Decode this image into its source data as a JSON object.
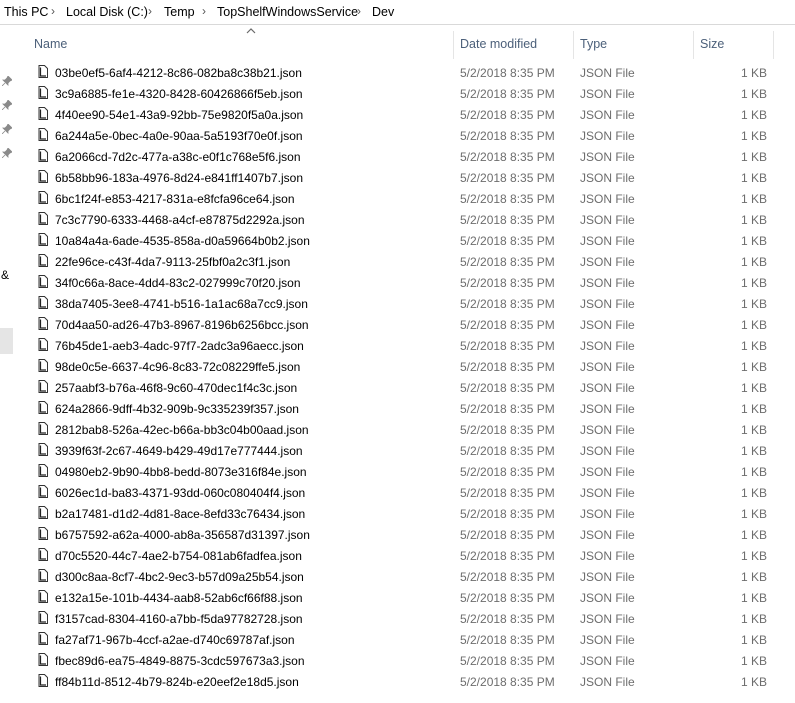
{
  "breadcrumb": {
    "items": [
      "This PC",
      "Local Disk (C:)",
      "Temp",
      "TopShelfWindowsService",
      "Dev"
    ],
    "separator": "›"
  },
  "columns": {
    "name": "Name",
    "date": "Date modified",
    "type": "Type",
    "size": "Size"
  },
  "nav": {
    "pins": [
      "pin-icon",
      "pin-icon",
      "pin-icon",
      "pin-icon"
    ],
    "amp": "&"
  },
  "files": [
    {
      "name": "03be0ef5-6af4-4212-8c86-082ba8c38b21.json",
      "date": "5/2/2018 8:35 PM",
      "type": "JSON File",
      "size": "1 KB"
    },
    {
      "name": "3c9a6885-fe1e-4320-8428-60426866f5eb.json",
      "date": "5/2/2018 8:35 PM",
      "type": "JSON File",
      "size": "1 KB"
    },
    {
      "name": "4f40ee90-54e1-43a9-92bb-75e9820f5a0a.json",
      "date": "5/2/2018 8:35 PM",
      "type": "JSON File",
      "size": "1 KB"
    },
    {
      "name": "6a244a5e-0bec-4a0e-90aa-5a5193f70e0f.json",
      "date": "5/2/2018 8:35 PM",
      "type": "JSON File",
      "size": "1 KB"
    },
    {
      "name": "6a2066cd-7d2c-477a-a38c-e0f1c768e5f6.json",
      "date": "5/2/2018 8:35 PM",
      "type": "JSON File",
      "size": "1 KB"
    },
    {
      "name": "6b58bb96-183a-4976-8d24-e841ff1407b7.json",
      "date": "5/2/2018 8:35 PM",
      "type": "JSON File",
      "size": "1 KB"
    },
    {
      "name": "6bc1f24f-e853-4217-831a-e8fcfa96ce64.json",
      "date": "5/2/2018 8:35 PM",
      "type": "JSON File",
      "size": "1 KB"
    },
    {
      "name": "7c3c7790-6333-4468-a4cf-e87875d2292a.json",
      "date": "5/2/2018 8:35 PM",
      "type": "JSON File",
      "size": "1 KB"
    },
    {
      "name": "10a84a4a-6ade-4535-858a-d0a59664b0b2.json",
      "date": "5/2/2018 8:35 PM",
      "type": "JSON File",
      "size": "1 KB"
    },
    {
      "name": "22fe96ce-c43f-4da7-9113-25fbf0a2c3f1.json",
      "date": "5/2/2018 8:35 PM",
      "type": "JSON File",
      "size": "1 KB"
    },
    {
      "name": "34f0c66a-8ace-4dd4-83c2-027999c70f20.json",
      "date": "5/2/2018 8:35 PM",
      "type": "JSON File",
      "size": "1 KB"
    },
    {
      "name": "38da7405-3ee8-4741-b516-1a1ac68a7cc9.json",
      "date": "5/2/2018 8:35 PM",
      "type": "JSON File",
      "size": "1 KB"
    },
    {
      "name": "70d4aa50-ad26-47b3-8967-8196b6256bcc.json",
      "date": "5/2/2018 8:35 PM",
      "type": "JSON File",
      "size": "1 KB"
    },
    {
      "name": "76b45de1-aeb3-4adc-97f7-2adc3a96aecc.json",
      "date": "5/2/2018 8:35 PM",
      "type": "JSON File",
      "size": "1 KB"
    },
    {
      "name": "98de0c5e-6637-4c96-8c83-72c08229ffe5.json",
      "date": "5/2/2018 8:35 PM",
      "type": "JSON File",
      "size": "1 KB"
    },
    {
      "name": "257aabf3-b76a-46f8-9c60-470dec1f4c3c.json",
      "date": "5/2/2018 8:35 PM",
      "type": "JSON File",
      "size": "1 KB"
    },
    {
      "name": "624a2866-9dff-4b32-909b-9c335239f357.json",
      "date": "5/2/2018 8:35 PM",
      "type": "JSON File",
      "size": "1 KB"
    },
    {
      "name": "2812bab8-526a-42ec-b66a-bb3c04b00aad.json",
      "date": "5/2/2018 8:35 PM",
      "type": "JSON File",
      "size": "1 KB"
    },
    {
      "name": "3939f63f-2c67-4649-b429-49d17e777444.json",
      "date": "5/2/2018 8:35 PM",
      "type": "JSON File",
      "size": "1 KB"
    },
    {
      "name": "04980eb2-9b90-4bb8-bedd-8073e316f84e.json",
      "date": "5/2/2018 8:35 PM",
      "type": "JSON File",
      "size": "1 KB"
    },
    {
      "name": "6026ec1d-ba83-4371-93dd-060c080404f4.json",
      "date": "5/2/2018 8:35 PM",
      "type": "JSON File",
      "size": "1 KB"
    },
    {
      "name": "b2a17481-d1d2-4d81-8ace-8efd33c76434.json",
      "date": "5/2/2018 8:35 PM",
      "type": "JSON File",
      "size": "1 KB"
    },
    {
      "name": "b6757592-a62a-4000-ab8a-356587d31397.json",
      "date": "5/2/2018 8:35 PM",
      "type": "JSON File",
      "size": "1 KB"
    },
    {
      "name": "d70c5520-44c7-4ae2-b754-081ab6fadfea.json",
      "date": "5/2/2018 8:35 PM",
      "type": "JSON File",
      "size": "1 KB"
    },
    {
      "name": "d300c8aa-8cf7-4bc2-9ec3-b57d09a25b54.json",
      "date": "5/2/2018 8:35 PM",
      "type": "JSON File",
      "size": "1 KB"
    },
    {
      "name": "e132a15e-101b-4434-aab8-52ab6cf66f88.json",
      "date": "5/2/2018 8:35 PM",
      "type": "JSON File",
      "size": "1 KB"
    },
    {
      "name": "f3157cad-8304-4160-a7bb-f5da97782728.json",
      "date": "5/2/2018 8:35 PM",
      "type": "JSON File",
      "size": "1 KB"
    },
    {
      "name": "fa27af71-967b-4ccf-a2ae-d740c69787af.json",
      "date": "5/2/2018 8:35 PM",
      "type": "JSON File",
      "size": "1 KB"
    },
    {
      "name": "fbec89d6-ea75-4849-8875-3cdc597673a3.json",
      "date": "5/2/2018 8:35 PM",
      "type": "JSON File",
      "size": "1 KB"
    },
    {
      "name": "ff84b11d-8512-4b79-824b-e20eef2e18d5.json",
      "date": "5/2/2018 8:35 PM",
      "type": "JSON File",
      "size": "1 KB"
    }
  ]
}
